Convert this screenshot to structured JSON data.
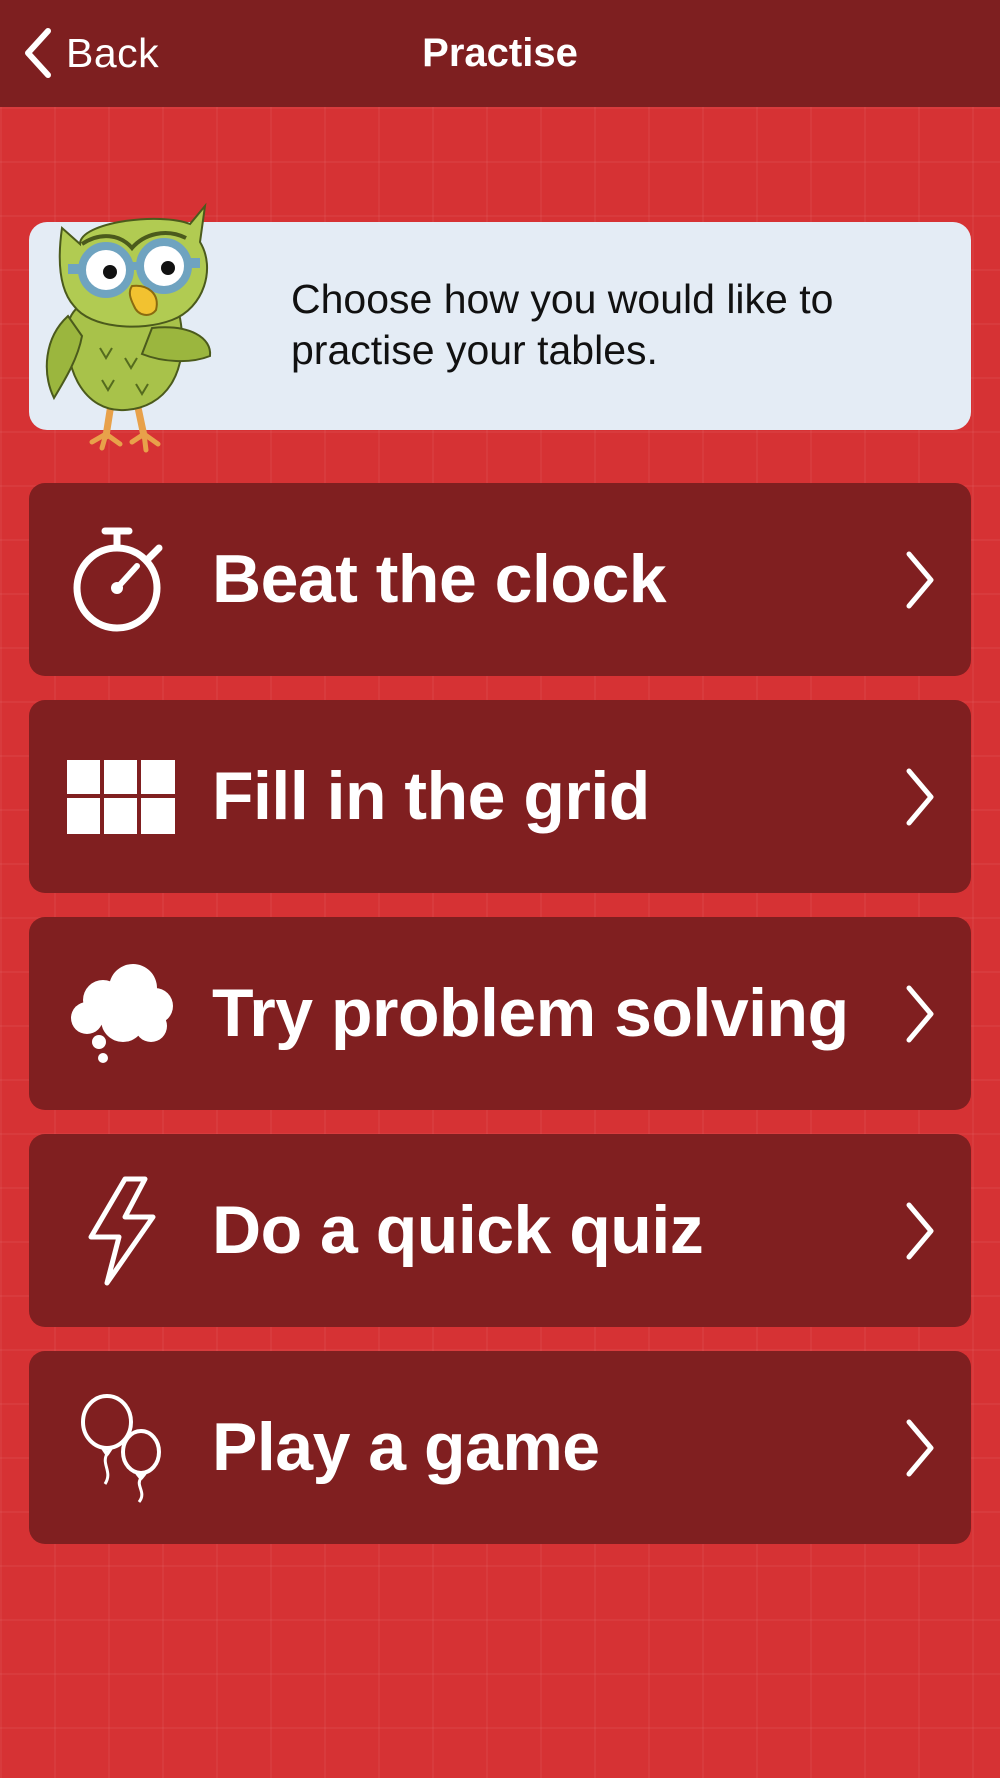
{
  "nav": {
    "back_label": "Back",
    "title": "Practise"
  },
  "intro": {
    "text": "Choose how you would like to practise your tables."
  },
  "menu": [
    {
      "label": "Beat the clock",
      "icon": "stopwatch-icon"
    },
    {
      "label": "Fill in the grid",
      "icon": "grid-icon"
    },
    {
      "label": "Try problem solving",
      "icon": "thought-cloud-icon"
    },
    {
      "label": "Do a quick quiz",
      "icon": "lightning-bolt-icon"
    },
    {
      "label": "Play a game",
      "icon": "balloons-icon"
    }
  ],
  "colors": {
    "background": "#d63234",
    "navbar": "#7e1f20",
    "menu_item": "#801f20",
    "intro_card": "#e4ecf5",
    "text_light": "#ffffff"
  }
}
